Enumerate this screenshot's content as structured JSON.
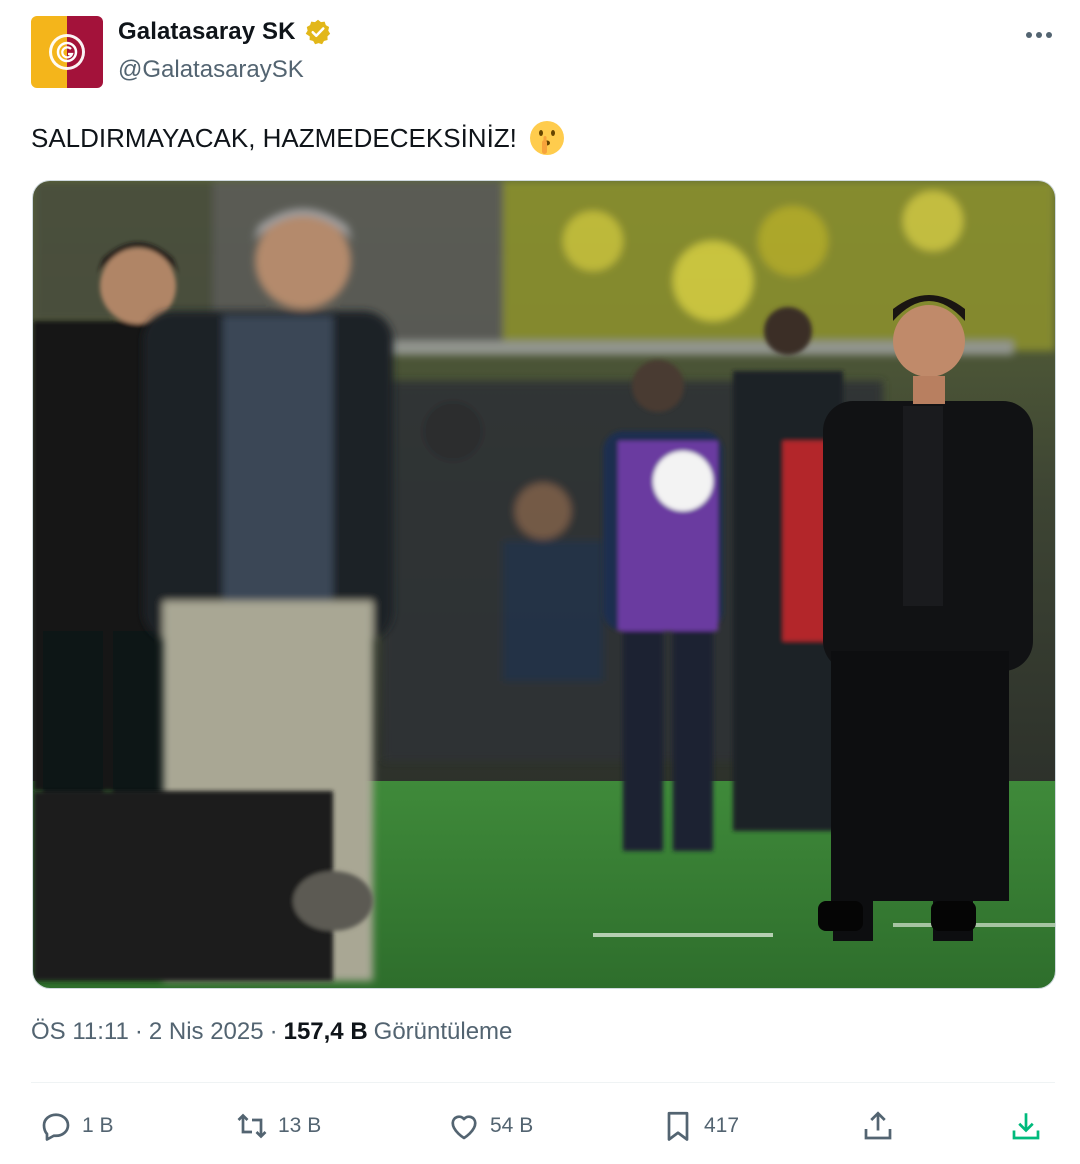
{
  "account": {
    "display_name": "Galatasaray SK",
    "handle": "@GalatasaraySK",
    "verified": true,
    "avatar_icon": "galatasaray-crest",
    "brand_colors": {
      "yellow": "#f4b51b",
      "red": "#a3123a"
    }
  },
  "more_icon": "more-dots-icon",
  "tweet": {
    "text": "SALDIRMAYACAK, HAZMEDECEKSİNİZ!",
    "emoji": "shushing-face"
  },
  "media": {
    "type": "photo"
  },
  "meta": {
    "time": "ÖS 11:11",
    "separator1": "·",
    "date": "2 Nis 2025",
    "separator2": "·",
    "views_count": "157,4 B",
    "views_label": "Görüntüleme"
  },
  "actions": {
    "reply": {
      "icon": "reply-icon",
      "count": "1 B"
    },
    "retweet": {
      "icon": "retweet-icon",
      "count": "13 B"
    },
    "like": {
      "icon": "heart-icon",
      "count": "54 B"
    },
    "bookmark": {
      "icon": "bookmark-icon",
      "count": "417"
    },
    "share": {
      "icon": "share-icon"
    },
    "download": {
      "icon": "download-icon",
      "color": "#00ba7c"
    }
  }
}
